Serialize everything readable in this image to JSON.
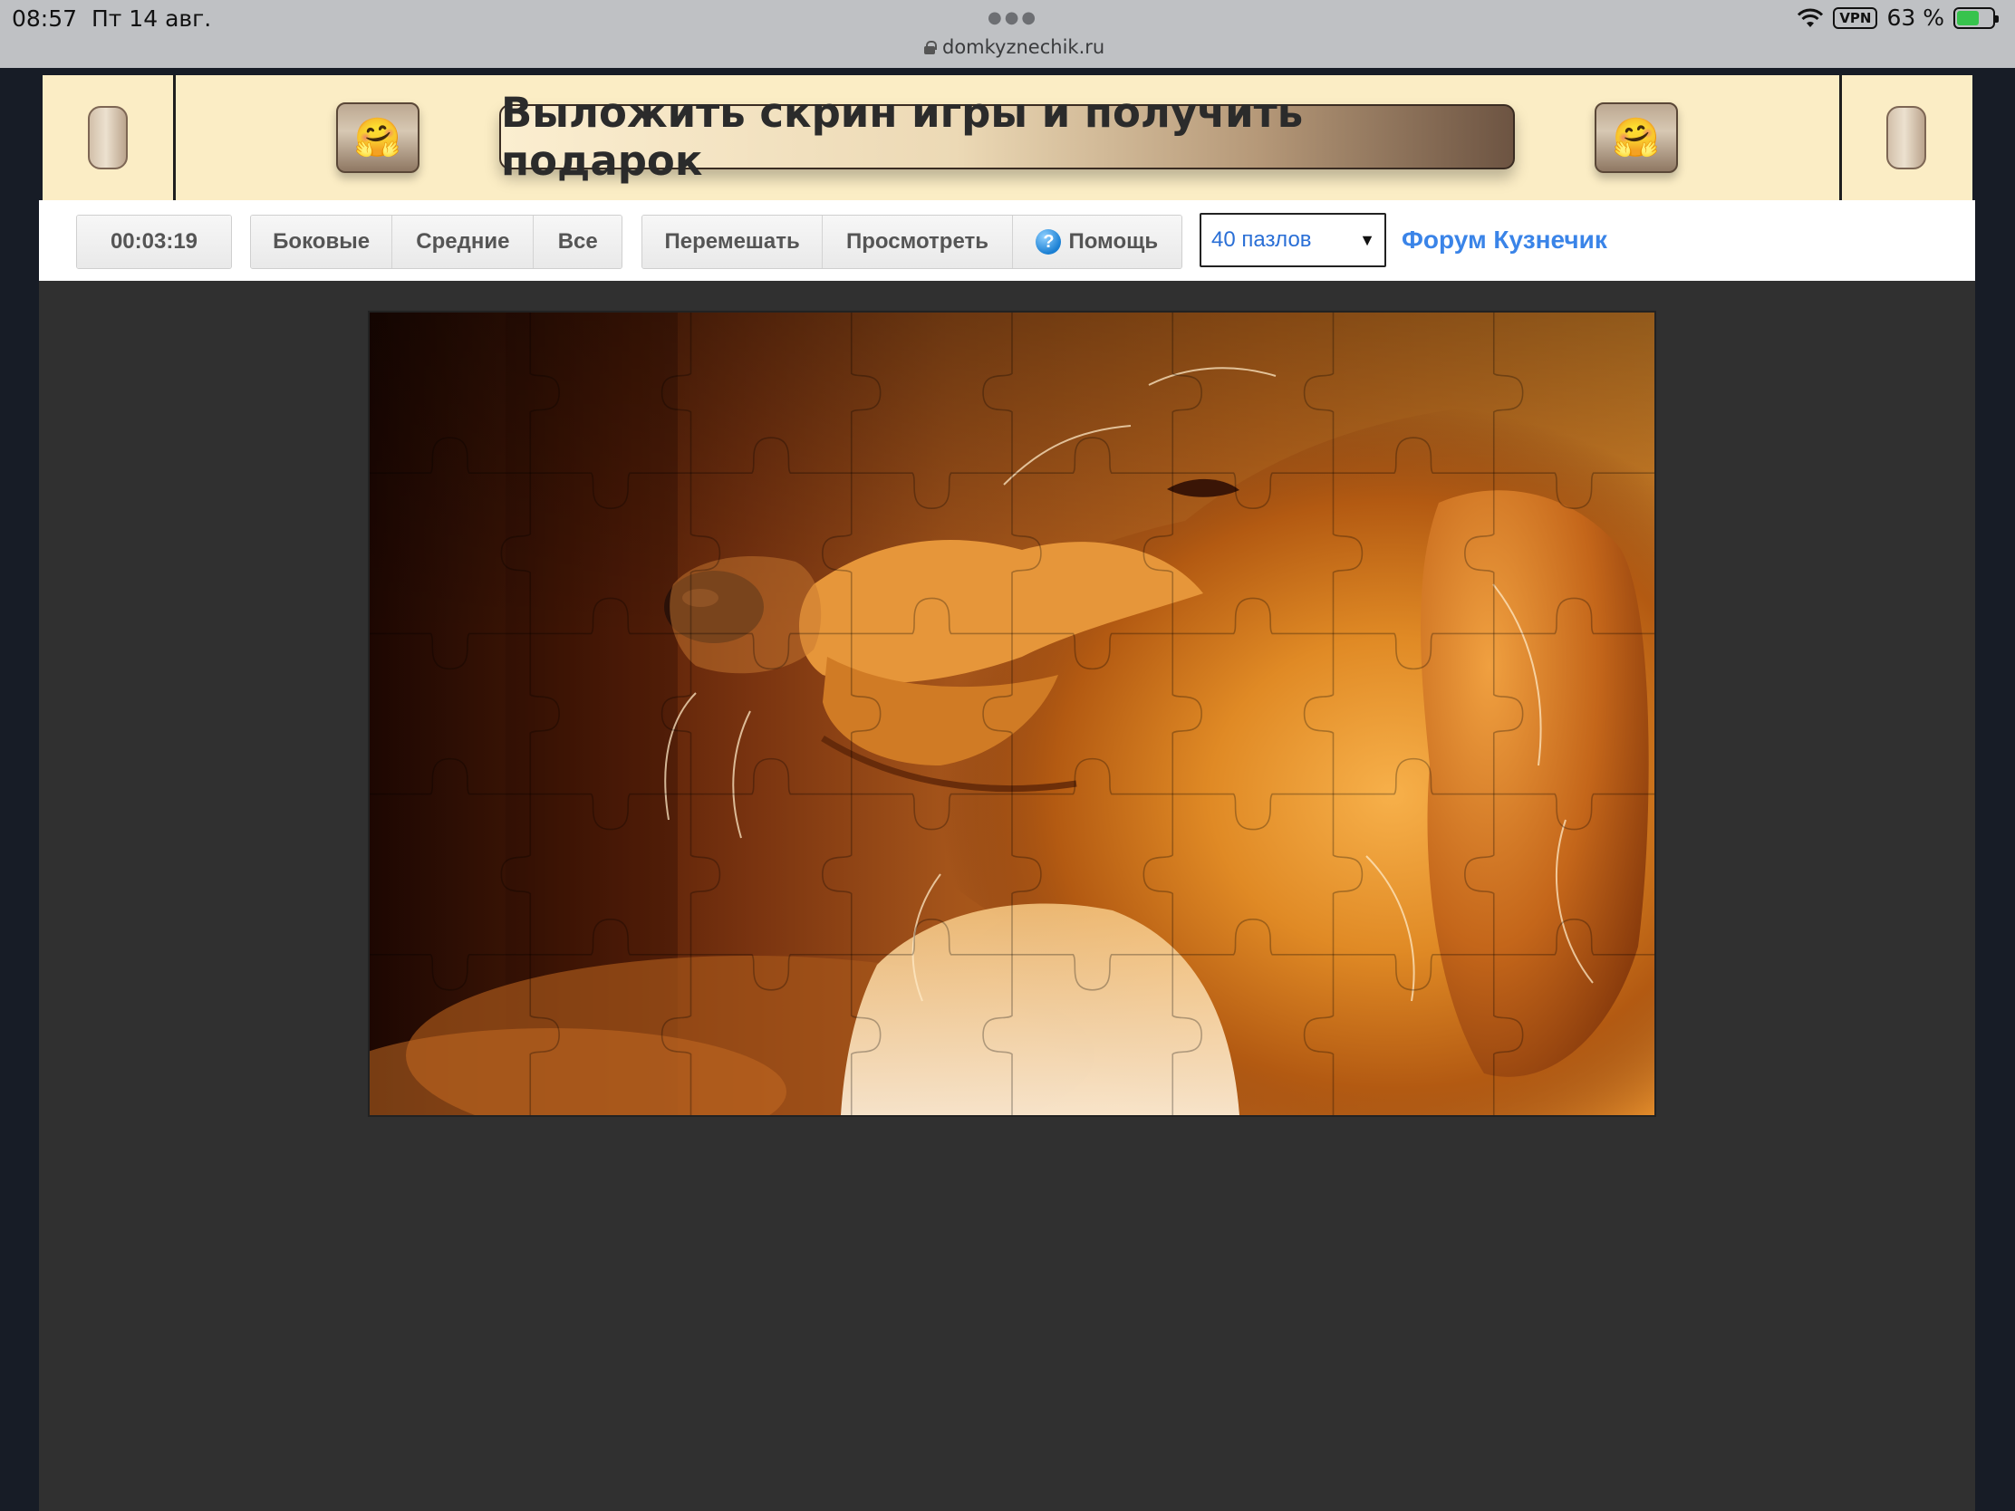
{
  "status_bar": {
    "time": "08:57",
    "date": "Пт 14 авг.",
    "url": "domkyznechik.ru",
    "vpn": "VPN",
    "battery": "63 %",
    "battery_level_pct": 63
  },
  "banner": {
    "cta": "Выложить скрин игры и получить подарок",
    "emoji": "🤗"
  },
  "toolbar": {
    "timer": "00:03:19",
    "filter_buttons": [
      "Боковые",
      "Средние",
      "Все"
    ],
    "action_buttons": {
      "shuffle": "Перемешать",
      "preview": "Просмотреть",
      "help": "Помощь",
      "help_icon": "?"
    },
    "select_value": "40 пазлов",
    "forum_link": "Форум Кузнечик"
  },
  "puzzle": {
    "pieces": 40,
    "columns": 8,
    "rows": 5,
    "image": "golden retriever dog portrait"
  },
  "colors": {
    "banner_bg": "#fbedc5",
    "game_bg": "#303030",
    "link": "#3a84e8",
    "select_text": "#2a6fd6"
  }
}
